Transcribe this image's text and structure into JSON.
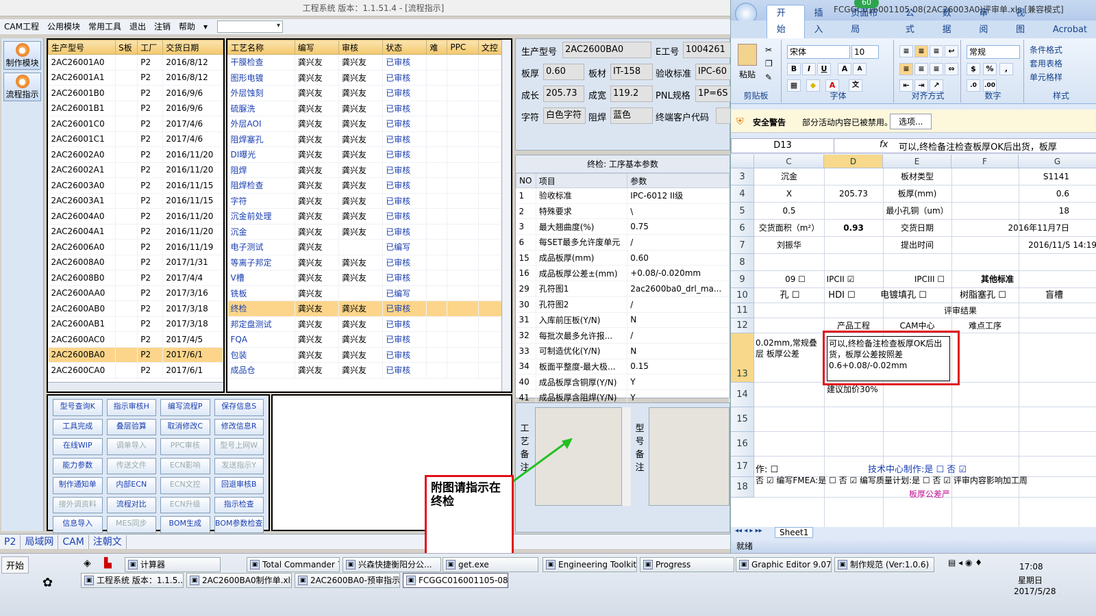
{
  "app": {
    "title": "工程系统  版本：1.1.51.4 - [流程指示]",
    "menu": [
      "CAM工程",
      "公用模块",
      "常用工具",
      "退出",
      "注销",
      "帮助"
    ]
  },
  "sidebar": {
    "buttons": [
      "制作模块",
      "流程指示"
    ]
  },
  "model_grid": {
    "headers": [
      "生产型号",
      "S板",
      "工厂",
      "交货日期"
    ],
    "rows": [
      [
        "2AC26001A0",
        "",
        "P2",
        "2016/8/12"
      ],
      [
        "2AC26001A1",
        "",
        "P2",
        "2016/8/12"
      ],
      [
        "2AC26001B0",
        "",
        "P2",
        "2016/9/6"
      ],
      [
        "2AC26001B1",
        "",
        "P2",
        "2016/9/6"
      ],
      [
        "2AC26001C0",
        "",
        "P2",
        "2017/4/6"
      ],
      [
        "2AC26001C1",
        "",
        "P2",
        "2017/4/6"
      ],
      [
        "2AC26002A0",
        "",
        "P2",
        "2016/11/20"
      ],
      [
        "2AC26002A1",
        "",
        "P2",
        "2016/11/20"
      ],
      [
        "2AC26003A0",
        "",
        "P2",
        "2016/11/15"
      ],
      [
        "2AC26003A1",
        "",
        "P2",
        "2016/11/15"
      ],
      [
        "2AC26004A0",
        "",
        "P2",
        "2016/11/20"
      ],
      [
        "2AC26004A1",
        "",
        "P2",
        "2016/11/20"
      ],
      [
        "2AC26006A0",
        "",
        "P2",
        "2016/11/19"
      ],
      [
        "2AC26008A0",
        "",
        "P2",
        "2017/1/31"
      ],
      [
        "2AC26008B0",
        "",
        "P2",
        "2017/4/4"
      ],
      [
        "2AC2600AA0",
        "",
        "P2",
        "2017/3/16"
      ],
      [
        "2AC2600AB0",
        "",
        "P2",
        "2017/3/18"
      ],
      [
        "2AC2600AB1",
        "",
        "P2",
        "2017/3/18"
      ],
      [
        "2AC2600AC0",
        "",
        "P2",
        "2017/4/5"
      ],
      [
        "2AC2600BA0",
        "",
        "P2",
        "2017/6/1"
      ],
      [
        "2AC2600CA0",
        "",
        "P2",
        "2017/6/1"
      ]
    ],
    "selected": 19
  },
  "process_grid": {
    "headers": [
      "工艺名称",
      "编写",
      "审核",
      "状态",
      "难",
      "PPC",
      "文控"
    ],
    "rows": [
      [
        "干膜检查",
        "龚兴友",
        "龚兴友",
        "已审核"
      ],
      [
        "图形电镀",
        "龚兴友",
        "龚兴友",
        "已审核"
      ],
      [
        "外层蚀刻",
        "龚兴友",
        "龚兴友",
        "已审核"
      ],
      [
        "硫脲洗",
        "龚兴友",
        "龚兴友",
        "已审核"
      ],
      [
        "外层AOI",
        "龚兴友",
        "龚兴友",
        "已审核"
      ],
      [
        "阻焊塞孔",
        "龚兴友",
        "龚兴友",
        "已审核"
      ],
      [
        "DI曝光",
        "龚兴友",
        "龚兴友",
        "已审核"
      ],
      [
        "阻焊",
        "龚兴友",
        "龚兴友",
        "已审核"
      ],
      [
        "阻焊检查",
        "龚兴友",
        "龚兴友",
        "已审核"
      ],
      [
        "字符",
        "龚兴友",
        "龚兴友",
        "已审核"
      ],
      [
        "沉金前处理",
        "龚兴友",
        "龚兴友",
        "已审核"
      ],
      [
        "沉金",
        "龚兴友",
        "龚兴友",
        "已审核"
      ],
      [
        "电子测试",
        "龚兴友",
        "",
        "已编写"
      ],
      [
        "等离子邦定",
        "龚兴友",
        "龚兴友",
        "已审核"
      ],
      [
        "V槽",
        "龚兴友",
        "龚兴友",
        "已审核"
      ],
      [
        "铣板",
        "龚兴友",
        "",
        "已编写"
      ],
      [
        "终检",
        "龚兴友",
        "龚兴友",
        "已审核"
      ],
      [
        "邦定盘测试",
        "龚兴友",
        "龚兴友",
        "已审核"
      ],
      [
        "FQA",
        "龚兴友",
        "龚兴友",
        "已审核"
      ],
      [
        "包装",
        "龚兴友",
        "龚兴友",
        "已审核"
      ],
      [
        "成品仓",
        "龚兴友",
        "龚兴友",
        "已审核"
      ]
    ],
    "selected": 16
  },
  "function_buttons": [
    [
      "型号查询K",
      1
    ],
    [
      "指示审核H",
      1
    ],
    [
      "编写流程P",
      1
    ],
    [
      "保存信息S",
      1
    ],
    [
      "工具完成",
      1
    ],
    [
      "叠层验算",
      1
    ],
    [
      "取消修改C",
      1
    ],
    [
      "修改信息R",
      1
    ],
    [
      "在线WIP",
      1
    ],
    [
      "调单导入",
      0
    ],
    [
      "PPC审核",
      0
    ],
    [
      "型号上网W",
      0
    ],
    [
      "能力参数",
      1
    ],
    [
      "传送文件",
      0
    ],
    [
      "ECN影响",
      0
    ],
    [
      "发送指示Y",
      0
    ],
    [
      "制作通知单",
      1
    ],
    [
      "内部ECN",
      1
    ],
    [
      "ECN文控",
      0
    ],
    [
      "回退审核B",
      1
    ],
    [
      "接外调资料",
      0
    ],
    [
      "流程对比",
      1
    ],
    [
      "ECN升级",
      0
    ],
    [
      "指示检查",
      1
    ],
    [
      "信息导入",
      1
    ],
    [
      "MES同步",
      0
    ],
    [
      "BOM生成",
      1
    ],
    [
      "BOM参数检查",
      1
    ]
  ],
  "info": {
    "model_label": "生产型号",
    "model": "2AC2600BA0",
    "eno_label": "E工号",
    "eno": "1004261",
    "thick_label": "板厚",
    "thick": "0.60",
    "mat_label": "板材",
    "mat": "IT-158",
    "std_label": "验收标准",
    "std": "IPC-60",
    "len_label": "成长",
    "len": "205.73",
    "wid_label": "成宽",
    "wid": "119.2",
    "pnl_label": "PNL规格",
    "pnl": "1P=6S",
    "char_label": "字符",
    "char": "白色字符",
    "mask_label": "阻焊",
    "mask": "蓝色",
    "cust_label": "终端客户代码",
    "cust": ""
  },
  "params": {
    "title": "终检: 工序基本参数",
    "headers": [
      "NO",
      "项目",
      "参数"
    ],
    "rows": [
      [
        "1",
        "验收标准",
        "IPC-6012 II级"
      ],
      [
        "2",
        "特殊要求",
        "\\"
      ],
      [
        "3",
        "最大翘曲度(%)",
        "0.75"
      ],
      [
        "6",
        "每SET最多允许废单元",
        "/"
      ],
      [
        "15",
        "成品板厚(mm)",
        "0.60"
      ],
      [
        "16",
        "成品板厚公差±(mm)",
        "+0.08/-0.020mm"
      ],
      [
        "29",
        "孔符图1",
        "2ac2600ba0_drl_ma..."
      ],
      [
        "30",
        "孔符图2",
        "/"
      ],
      [
        "31",
        "入库前压板(Y/N)",
        "N"
      ],
      [
        "32",
        "每批次最多允许报...",
        "/"
      ],
      [
        "33",
        "可制造优化(Y/N)",
        "N"
      ],
      [
        "34",
        "板面平整度-最大极...",
        "0.15"
      ],
      [
        "40",
        "成品板厚含铜厚(Y/N)",
        "Y"
      ],
      [
        "41",
        "成品板厚含阻焊(Y/N)",
        "Y"
      ]
    ]
  },
  "notes": {
    "process_label": "工艺备注",
    "model_label": "型号备注"
  },
  "bottom_tabs": [
    "P2",
    "局域网",
    "CAM",
    "注朝文"
  ],
  "annotation": "附图请指示在终检",
  "excel": {
    "title": "FCGGC016001105-08(2AC26003A0)评审单.xls [兼容模式]",
    "badge": "60",
    "tabs": [
      "开始",
      "插入",
      "页面布局",
      "公式",
      "数据",
      "审阅",
      "视图",
      "Acrobat"
    ],
    "font": "宋体",
    "size": "10",
    "numfmt": "常规",
    "groups": [
      "剪贴板",
      "字体",
      "对齐方式",
      "数字",
      "样式"
    ],
    "paste": "粘贴",
    "styles": [
      "条件格式",
      "套用表格",
      "单元格样"
    ],
    "security": "安全警告",
    "security_msg": "部分活动内容已被禁用。",
    "options": "选项...",
    "cellref": "D13",
    "fx": "fx",
    "formula": "可以,终检备注检查板厚OK后出货，板厚",
    "cols": [
      "C",
      "D",
      "E",
      "F",
      "G"
    ],
    "rows": [
      "3",
      "4",
      "5",
      "6",
      "7",
      "8",
      "9",
      "10",
      "11",
      "12",
      "13",
      "14",
      "15",
      "16",
      "17",
      "18"
    ],
    "c3": "沉金",
    "e3": "板材类型",
    "g3": "S1141",
    "c4": "X",
    "d4": "205.73",
    "e4": "板厚(mm)",
    "g4": "0.6",
    "c5": "0.5",
    "e5": "最小孔铜（um）",
    "g5": "18",
    "c6": "交货面积（m²）",
    "d6": "0.93",
    "e6": "交货日期",
    "g6": "2016年11月7日",
    "c7": "刘振华",
    "e7": "提出时间",
    "g7": "2016/11/5 14:19",
    "r9": [
      "09 ☐",
      "IPCII ☑",
      "IPCIII ☐",
      "其他标准"
    ],
    "r10": [
      "孔 ☐",
      "HDI ☐",
      "电镀填孔 ☐",
      "树脂塞孔 ☐",
      "盲槽"
    ],
    "r11": "评审结果",
    "r12": [
      "产品工程",
      "CAM中心",
      "难点工序"
    ],
    "c13": "0.02mm,常规叠层 板厚公差",
    "d13": "可以,终检备注检查板厚OK后出货，板厚公差按照差0.6+0.08/-0.02mm",
    "d14": "建议加价30%",
    "r18a": "作: ☐",
    "r18b": "技术中心制作:是 ☐  否 ☑",
    "r18c": "否 ☑  编写FMEA:是 ☐  否 ☑  编写质量计划:是 ☐  否 ☑  评审内容影响加工周",
    "r19": "板厚公差严",
    "sheet": "Sheet1",
    "status": "就绪"
  },
  "taskbar": {
    "start": "开始",
    "items": [
      "计算器",
      "Total Commander 7.0...",
      "兴森快捷衡阳分公...",
      "get.exe",
      "Engineering Toolkit 9....",
      "Progress",
      "Graphic Editor 9.07b2...",
      "制作规范 (Ver:1.0.6)",
      "工程系统  版本：1.1.5...",
      "2AC2600BA0制作单.xls ...",
      "2AC2600BA0-预审指示....",
      "FCGGC016001105-08(..."
    ],
    "time": "17:08",
    "day": "星期日",
    "date": "2017/5/28"
  },
  "colors": {
    "accent": "#1a3fb0",
    "selected_row": "#fcd58a",
    "header": "#f3c86c",
    "annotation_border": "#e0101a",
    "arrow": "#22c022"
  }
}
